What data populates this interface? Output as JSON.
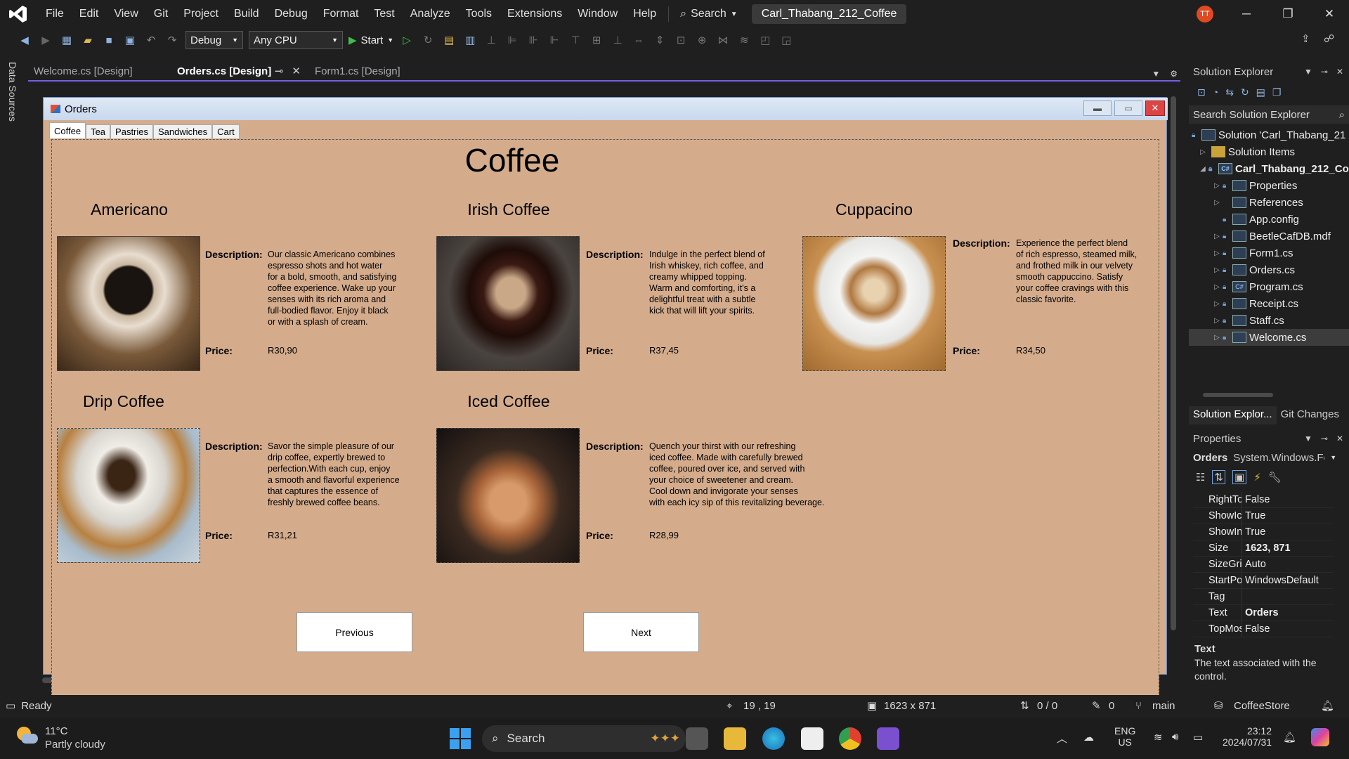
{
  "menu": [
    "File",
    "Edit",
    "View",
    "Git",
    "Project",
    "Build",
    "Debug",
    "Format",
    "Test",
    "Analyze",
    "Tools",
    "Extensions",
    "Window",
    "Help"
  ],
  "search_label": "Search",
  "solution_badge": "Carl_Thabang_212_Coffee",
  "user_initials": "TT",
  "toolbar": {
    "config": "Debug",
    "platform": "Any CPU",
    "start": "Start"
  },
  "left_strip_label": "Data Sources",
  "doc_tabs": [
    "Welcome.cs [Design]",
    "Orders.cs [Design]",
    "Form1.cs [Design]"
  ],
  "form": {
    "title": "Orders",
    "tabs": [
      "Coffee",
      "Tea",
      "Pastries",
      "Sandwiches",
      "Cart"
    ],
    "page_title": "Coffee",
    "desc_label": "Description:",
    "price_label": "Price:",
    "products": [
      {
        "name": "Americano",
        "desc": "Our classic Americano combines\nespresso shots and hot water\nfor a bold, smooth, and satisfying\ncoffee experience. Wake up your\nsenses with its rich aroma and\nfull-bodied flavor. Enjoy it black\nor with a splash of cream.",
        "price": "R30,90"
      },
      {
        "name": "Irish Coffee",
        "desc": "Indulge in the perfect blend of\nIrish whiskey, rich coffee, and\ncreamy whipped topping.\n Warm and comforting, it's a\ndelightful treat with a subtle\nkick that will lift your spirits.",
        "price": "R37,45"
      },
      {
        "name": "Cuppacino",
        "desc": "Experience the perfect blend\nof rich espresso, steamed milk,\nand frothed milk in our velvety\nsmooth cappuccino. Satisfy\nyour coffee cravings with this\nclassic favorite.",
        "price": "R34,50"
      },
      {
        "name": "Drip Coffee",
        "desc": "Savor the simple pleasure of our\ndrip coffee, expertly brewed to\nperfection.With each cup, enjoy\na smooth and flavorful experience\nthat captures the essence of\nfreshly brewed coffee beans.",
        "price": "R31,21"
      },
      {
        "name": "Iced Coffee",
        "desc": "Quench your thirst with our refreshing\niced coffee. Made with carefully brewed\ncoffee, poured over ice, and served with\nyour choice of sweetener and cream.\nCool down and invigorate your senses\nwith each icy sip of this revitalizing beverage.",
        "price": "R28,99"
      }
    ],
    "prev_label": "Previous",
    "next_label": "Next"
  },
  "solution_explorer": {
    "title": "Solution Explorer",
    "search_placeholder": "Search Solution Explorer",
    "items": [
      {
        "label": "Solution 'Carl_Thabang_21",
        "icon": "solution-icon"
      },
      {
        "label": "Solution Items",
        "icon": "folder-icon"
      },
      {
        "label": "Carl_Thabang_212_Co",
        "icon": "project-icon"
      },
      {
        "label": "Properties",
        "icon": "wrench-icon"
      },
      {
        "label": "References",
        "icon": "references-icon"
      },
      {
        "label": "App.config",
        "icon": "config-icon"
      },
      {
        "label": "BeetleCafDB.mdf",
        "icon": "database-icon"
      },
      {
        "label": "Form1.cs",
        "icon": "form-icon"
      },
      {
        "label": "Orders.cs",
        "icon": "form-icon"
      },
      {
        "label": "Program.cs",
        "icon": "csharp-icon"
      },
      {
        "label": "Receipt.cs",
        "icon": "form-icon"
      },
      {
        "label": "Staff.cs",
        "icon": "form-icon"
      },
      {
        "label": "Welcome.cs",
        "icon": "form-icon"
      }
    ],
    "tabs": [
      "Solution Explor...",
      "Git Changes"
    ]
  },
  "properties": {
    "title": "Properties",
    "object": "Orders",
    "object_type": "System.Windows.For",
    "rows": [
      {
        "name": "RightToLe",
        "value": "False"
      },
      {
        "name": "ShowIcor",
        "value": "True"
      },
      {
        "name": "ShowInTa",
        "value": "True"
      },
      {
        "name": "Size",
        "value": "1623, 871"
      },
      {
        "name": "SizeGripS",
        "value": "Auto"
      },
      {
        "name": "StartPosit",
        "value": "WindowsDefault"
      },
      {
        "name": "Tag",
        "value": ""
      },
      {
        "name": "Text",
        "value": "Orders"
      },
      {
        "name": "TopMost",
        "value": "False"
      }
    ],
    "help_title": "Text",
    "help_text": "The text associated with the control."
  },
  "status": {
    "ready": "Ready",
    "position": "19 , 19",
    "size": "1623 x 871",
    "changes": "0 / 0",
    "edits": "0",
    "branch": "main",
    "repo": "CoffeeStore"
  },
  "taskbar": {
    "temp": "11°C",
    "weather": "Partly cloudy",
    "search": "Search",
    "lang1": "ENG",
    "lang2": "US",
    "time": "23:12",
    "date": "2024/07/31"
  },
  "colors": {
    "form_bg": "#d4ac8c",
    "accent": "#7160e8"
  }
}
